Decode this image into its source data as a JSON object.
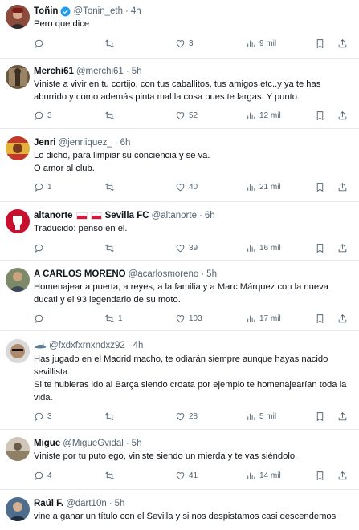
{
  "colors": {
    "text": "#0f1419",
    "muted": "#536471",
    "verified": "#1d9bf0",
    "divider": "#e7e9ea"
  },
  "tweets": [
    {
      "name": "Toñin",
      "handle": "@Tonin_eth",
      "time": "4h",
      "verified": true,
      "text": "Pero que dice",
      "replies": "",
      "retweets": "",
      "likes": "3",
      "views": "9 mil"
    },
    {
      "name": "Merchi61",
      "handle": "@merchi61",
      "time": "5h",
      "text": "Viniste a vivir en tu cortijo, con tus caballitos, tus amigos etc..y ya te has aburrido y como además pinta mal la cosa pues te largas. Y punto.",
      "replies": "3",
      "retweets": "",
      "likes": "52",
      "views": "12 mil"
    },
    {
      "name": "Jenri",
      "handle": "@jenriiquez_",
      "time": "6h",
      "text": "Lo dicho, para limpiar su conciencia y se va.\nO amor al club.",
      "replies": "1",
      "retweets": "",
      "likes": "40",
      "views": "21 mil"
    },
    {
      "name": "altanorte",
      "extra": "Sevilla FC",
      "handle": "@altanorte",
      "time": "6h",
      "text": "Traducido: pensó en él.",
      "replies": "",
      "retweets": "",
      "likes": "39",
      "views": "16 mil"
    },
    {
      "name": "A CARLOS MORENO",
      "handle": "@acarlosmoreno",
      "time": "5h",
      "text": "Homenajear a puerta, a reyes, a la familia y a Marc Márquez con la nueva ducati y el 93 legendario de su moto.",
      "replies": "",
      "retweets": "1",
      "likes": "103",
      "views": "17 mil"
    },
    {
      "name": "",
      "handle": "@fxdxfxrnxndxz92",
      "time": "4h",
      "text": "Has jugado en el Madrid macho, te odiarán siempre aunque hayas nacido sevillista.\nSi te hubieras ido al Barça siendo croata por ejemplo te homenajearían toda la vida.",
      "replies": "3",
      "retweets": "",
      "likes": "28",
      "views": "5 mil"
    },
    {
      "name": "Migue",
      "handle": "@MigueGvidal",
      "time": "5h",
      "text": "Viniste por tu puto ego, viniste siendo un mierda y te vas siéndolo.",
      "replies": "4",
      "retweets": "",
      "likes": "41",
      "views": "14 mil"
    },
    {
      "name": "Raúl F.",
      "handle": "@dart10n",
      "time": "5h",
      "text": "vine a ganar un título con el Sevilla y si nos despistamos casi descendemos",
      "replies": "",
      "retweets": "",
      "likes": "",
      "views": ""
    }
  ]
}
